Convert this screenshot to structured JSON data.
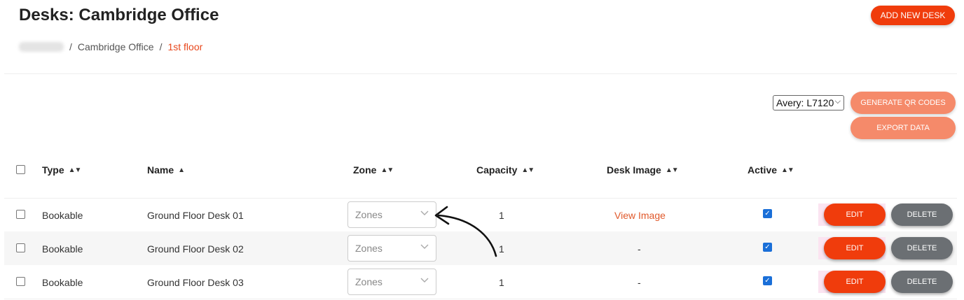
{
  "header": {
    "title": "Desks: Cambridge Office",
    "add_button": "ADD NEW DESK"
  },
  "breadcrumb": {
    "items": [
      "Cambridge Office"
    ],
    "current": "1st floor",
    "separator": "/"
  },
  "toolbar": {
    "label_format": "Avery: L7120",
    "qr_button": "GENERATE QR CODES",
    "export_button": "EXPORT DATA"
  },
  "table": {
    "columns": {
      "type": "Type",
      "name": "Name",
      "zone": "Zone",
      "capacity": "Capacity",
      "desk_image": "Desk Image",
      "active": "Active"
    },
    "sort": {
      "column": "Name",
      "direction": "ascending"
    },
    "rows": [
      {
        "type": "Bookable",
        "name": "Ground Floor Desk 01",
        "zone_placeholder": "Zones",
        "capacity": "1",
        "desk_image": "View Image",
        "active": true,
        "edit": "EDIT",
        "delete": "DELETE"
      },
      {
        "type": "Bookable",
        "name": "Ground Floor Desk 02",
        "zone_placeholder": "Zones",
        "capacity": "1",
        "desk_image": "-",
        "active": true,
        "edit": "EDIT",
        "delete": "DELETE"
      },
      {
        "type": "Bookable",
        "name": "Ground Floor Desk 03",
        "zone_placeholder": "Zones",
        "capacity": "1",
        "desk_image": "-",
        "active": true,
        "edit": "EDIT",
        "delete": "DELETE"
      }
    ]
  },
  "colors": {
    "accent": "#f03c0c",
    "accent_light": "#f58a6a",
    "link": "#e0582a",
    "secondary": "#6b6f73",
    "checkbox": "#1a6fd8"
  },
  "icons": {
    "sort_both": "sort-icon",
    "sort_up": "sort-ascending-icon",
    "dropdown": "chevron-down-icon",
    "annotation": "curved-arrow-icon"
  }
}
